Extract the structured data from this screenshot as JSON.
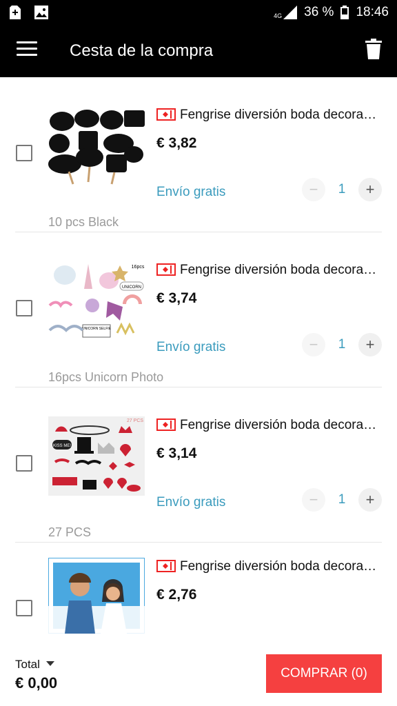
{
  "status": {
    "network": "4G",
    "battery": "36 %",
    "time": "18:46"
  },
  "app": {
    "title": "Cesta de la compra"
  },
  "items": [
    {
      "name": "Fengrise diversión boda decoración",
      "price": "€ 3,82",
      "shipping": "Envío gratis",
      "qty": "1",
      "variant": "10 pcs Black"
    },
    {
      "name": "Fengrise diversión boda decoración",
      "price": "€ 3,74",
      "shipping": "Envío gratis",
      "qty": "1",
      "variant": "16pcs Unicorn Photo"
    },
    {
      "name": "Fengrise diversión boda decoración",
      "price": "€ 3,14",
      "shipping": "Envío gratis",
      "qty": "1",
      "variant": "27 PCS"
    },
    {
      "name": "Fengrise diversión boda decoración",
      "price": "€ 2,76",
      "shipping": "",
      "qty": "",
      "variant": ""
    }
  ],
  "thumbs": {
    "unicorn_badge": "16pcs",
    "unicorn_sign": "UNICORN",
    "unicorn_selfie": "UNICORN SELFIE",
    "kiss_sign": "KISS ME!",
    "count_27": "27 PCS"
  },
  "footer": {
    "total_label": "Total",
    "total_value": "€ 0,00",
    "buy_label": "COMPRAR (0)"
  },
  "colors": {
    "accent": "#f54040",
    "link": "#3a9bbd",
    "bar": "#000000"
  },
  "icons": {
    "menu": "hamburger-icon",
    "delete": "trash-icon",
    "tag": "product-tag-icon"
  }
}
